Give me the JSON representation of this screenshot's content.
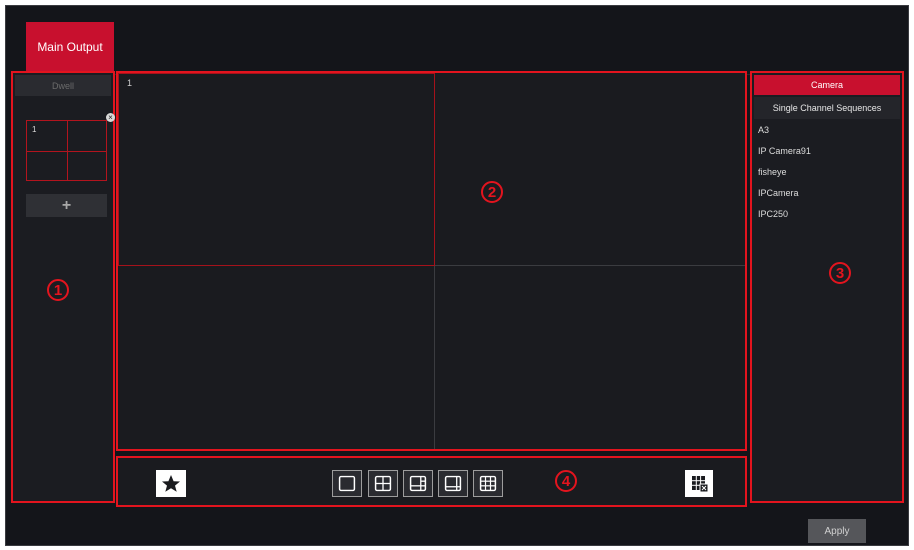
{
  "tabs": {
    "main_output": "Main Output"
  },
  "left_panel": {
    "header": "Dwell",
    "thumbnail_number": "1",
    "close_symbol": "×",
    "add_symbol": "+"
  },
  "view": {
    "window_number": "1"
  },
  "right_panel": {
    "tab_camera": "Camera",
    "tab_sequences": "Single Channel Sequences",
    "cameras": [
      "A3",
      "IP Camera91",
      "fisheye",
      "IPCamera",
      "IPC250"
    ]
  },
  "toolbar": {
    "favorite_icon": "star-icon",
    "layouts": [
      "layout-1-icon",
      "layout-4-icon",
      "layout-6-icon",
      "layout-8-icon",
      "layout-9-icon"
    ],
    "grid_icon": "grid-delete-icon"
  },
  "footer": {
    "apply_label": "Apply"
  },
  "callouts": {
    "c1": "1",
    "c2": "2",
    "c3": "3",
    "c4": "4"
  },
  "colors": {
    "accent": "#c8102e",
    "outline": "#e3141e",
    "background": "#14151a"
  }
}
